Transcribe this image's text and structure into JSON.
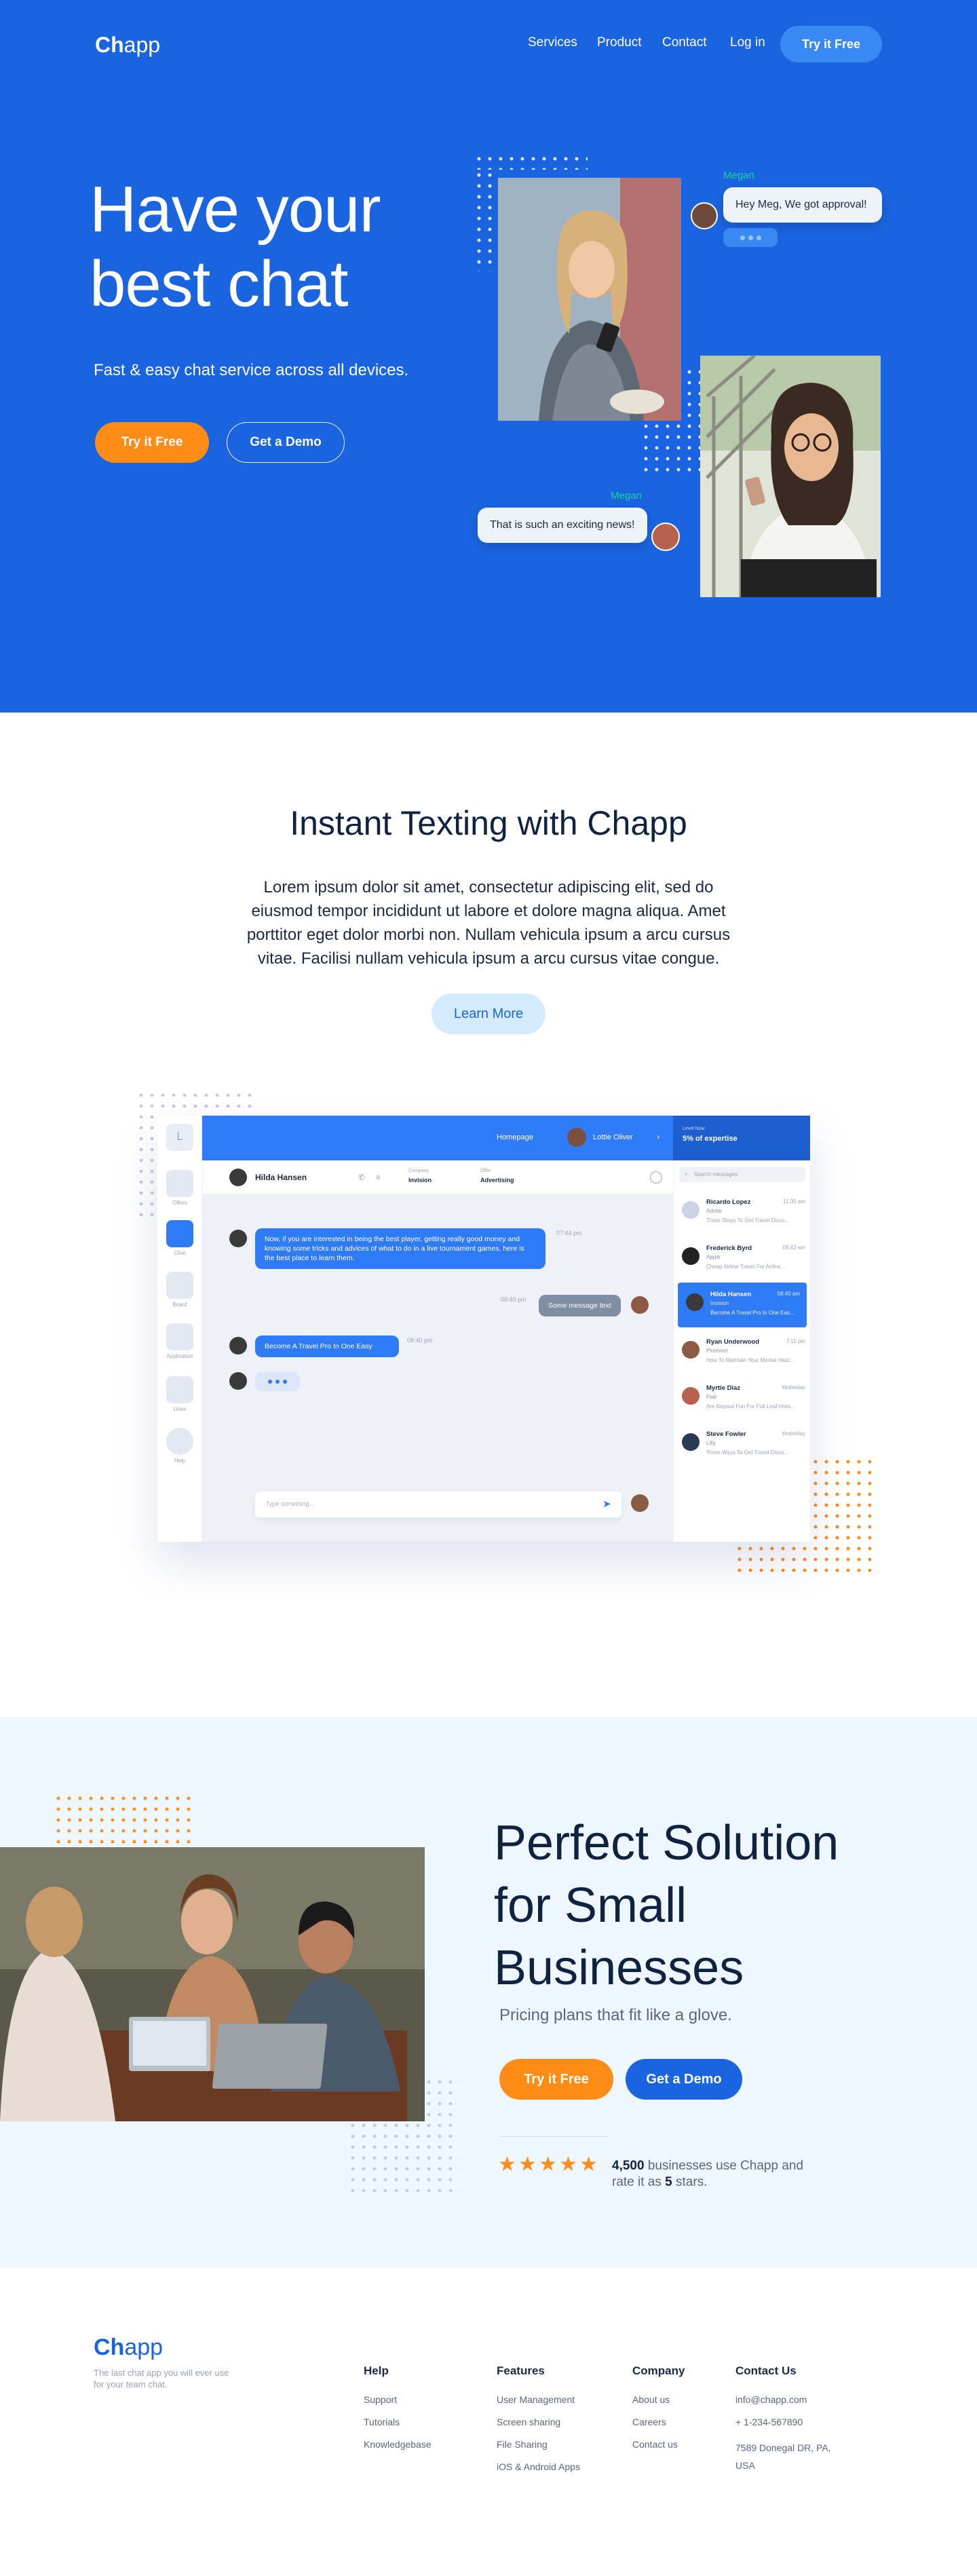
{
  "header": {
    "logo_ch": "Ch",
    "logo_app": "app",
    "nav": [
      "Services",
      "Product",
      "Contact",
      "Log in"
    ],
    "cta": "Try it Free"
  },
  "hero": {
    "title_line1": "Have your",
    "title_line2": "best chat",
    "subtitle": "Fast & easy chat service across all devices.",
    "primary_button": "Try it Free",
    "secondary_button": "Get a Demo",
    "chat1_name": "Megan",
    "chat1_text": "Hey Meg, We got approval!",
    "chat2_name": "Megan",
    "chat2_text": "That is such an exciting news!"
  },
  "texting": {
    "title": "Instant Texting with Chapp",
    "body": "Lorem ipsum dolor sit amet, consectetur adipiscing elit, sed do eiusmod tempor incididunt ut labore et dolore magna aliqua. Amet porttitor eget dolor morbi non. Nullam vehicula ipsum a arcu cursus vitae. Facilisi nullam vehicula ipsum a arcu cursus vitae congue.",
    "button": "Learn More"
  },
  "app": {
    "topbar_home": "Homepage",
    "topbar_user": "Lottie Oliver",
    "level_label": "Level Now",
    "level_value": "5% of expertise",
    "search_placeholder": "Search messages",
    "sidebar": [
      "Offers",
      "Chat",
      "Board",
      "Application",
      "Lines",
      "Help"
    ],
    "contact_name": "Hilda Hansen",
    "company_label": "Company",
    "company_value": "Invision",
    "offer_label": "Offer",
    "offer_value": "Advertising",
    "messages": [
      {
        "text": "Now, if you are interested in being the best player, getting really good money and knowing some tricks and advices of what to do in a live tournament games, here is the best place to learn them.",
        "time": "07:44 pm"
      },
      {
        "text": "Some message text",
        "time": "08:40 pm"
      },
      {
        "text": "Become A Travel Pro In One Easy",
        "time": "08:40 pm"
      }
    ],
    "input_placeholder": "Type something...",
    "contacts": [
      {
        "name": "Ricardo Lopez",
        "role": "Adobe",
        "preview": "Three Steps To Get Travel Disco...",
        "time": "11:30 am"
      },
      {
        "name": "Frederick Byrd",
        "role": "Apple",
        "preview": "Cheap Airline Travel For Airline...",
        "time": "09:42 am"
      },
      {
        "name": "Hilda Hansen",
        "role": "Invision",
        "preview": "Become A Travel Pro In One Eas...",
        "time": "08:40 am"
      },
      {
        "name": "Ryan Underwood",
        "role": "Pinterest",
        "preview": "How To Maintain Your Mental Heal...",
        "time": "7:11 pm"
      },
      {
        "name": "Myrtie Diaz",
        "role": "Flair",
        "preview": "Are Bayous Fun For Full Leaf Imes...",
        "time": "Yesterday"
      },
      {
        "name": "Steve Fowler",
        "role": "Lilly",
        "preview": "Three Ways To Get Travel Disco...",
        "time": "Yesterday"
      }
    ]
  },
  "solution": {
    "title_line1": "Perfect Solution",
    "title_line2": "for Small",
    "title_line3": "Businesses",
    "subtitle": "Pricing plans that fit like a glove.",
    "primary_button": "Try it Free",
    "secondary_button": "Get a Demo",
    "rating_count": "4,500",
    "rating_text1": " businesses use Chapp and",
    "rating_text2": "rate it as ",
    "rating_value": "5",
    "rating_text3": " stars."
  },
  "footer": {
    "logo_ch": "Ch",
    "logo_app": "app",
    "tagline": "The last chat app you will ever use for your team chat.",
    "columns": [
      {
        "title": "Help",
        "links": [
          "Support",
          "Tutorials",
          "Knowledgebase"
        ]
      },
      {
        "title": "Features",
        "links": [
          "User Management",
          "Screen sharing",
          "File Sharing",
          "iOS & Android Apps"
        ]
      },
      {
        "title": "Company",
        "links": [
          "About us",
          "Careers",
          "Contact us"
        ]
      },
      {
        "title": "Contact Us",
        "links": [
          "info@chapp.com",
          "+ 1-234-567890",
          "7589 Donegal DR, PA, USA"
        ]
      }
    ]
  },
  "colors": {
    "primary": "#1a64e0",
    "accent_orange": "#ff8c17",
    "light_bg": "#eef7fe",
    "dark_text": "#0f2340"
  }
}
